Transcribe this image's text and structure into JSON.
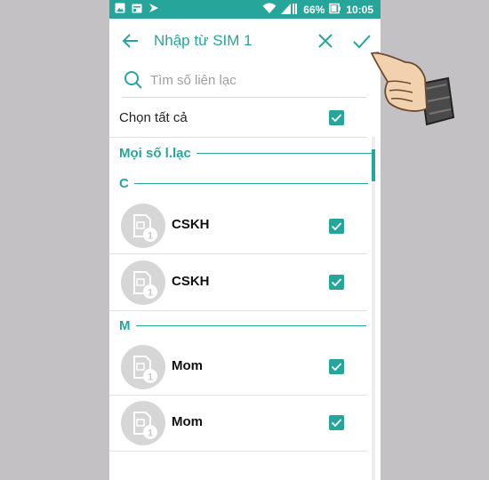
{
  "status_bar": {
    "battery": "66%",
    "time": "10:05"
  },
  "appbar": {
    "title": "Nhập từ SIM 1"
  },
  "search": {
    "placeholder": "Tìm số liên lạc"
  },
  "select_all": {
    "label": "Chọn tất cả",
    "checked": true
  },
  "list": {
    "all_header": "Mọi số l.lạc",
    "groups": [
      {
        "letter": "C",
        "contacts": [
          {
            "name": "CSKH",
            "checked": true
          },
          {
            "name": "CSKH",
            "checked": true
          }
        ]
      },
      {
        "letter": "M",
        "contacts": [
          {
            "name": "Mom",
            "checked": true
          },
          {
            "name": "Mom",
            "checked": true
          }
        ]
      }
    ]
  },
  "colors": {
    "accent": "#26a69a",
    "background": "#c3c1c4",
    "avatar": "#d6d6d6"
  },
  "icons": [
    "image-icon",
    "calendar-icon",
    "flag-icon",
    "wifi-icon",
    "signal-icon",
    "battery-icon",
    "back-arrow-icon",
    "close-icon",
    "check-icon",
    "search-icon",
    "sim-card-icon",
    "pointing-hand-icon"
  ]
}
